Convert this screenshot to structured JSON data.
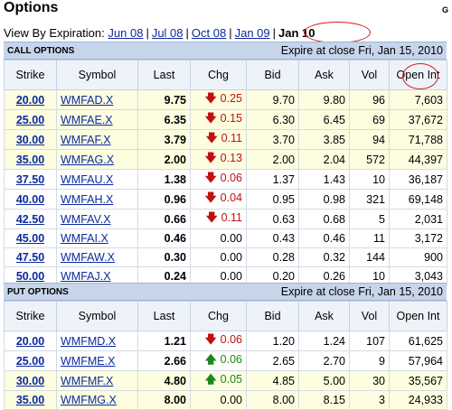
{
  "page_title": "Options",
  "corner_text": "G",
  "expiration": {
    "label": "View By Expiration:",
    "links": [
      "Jun 08",
      "Jul 08",
      "Oct 08",
      "Jan 09"
    ],
    "current": "Jan 10"
  },
  "colors": {
    "link": "#0b2a9e",
    "down": "#c21010",
    "up": "#1a8a1a",
    "highlight_oval": "#d21c1c",
    "in_the_money_row": "#fdfde0",
    "section_header": "#c6d5ea"
  },
  "columns": [
    "Strike",
    "Symbol",
    "Last",
    "Chg",
    "Bid",
    "Ask",
    "Vol",
    "Open Int"
  ],
  "call": {
    "title": "CALL OPTIONS",
    "expire": "Expire at close Fri, Jan 15, 2010",
    "rows": [
      {
        "strike": "20.00",
        "symbol": "WMFAD.X",
        "last": "9.75",
        "chg": "0.25",
        "dir": "down",
        "bid": "9.70",
        "ask": "9.80",
        "vol": "96",
        "oi": "7,603",
        "itm": true
      },
      {
        "strike": "25.00",
        "symbol": "WMFAE.X",
        "last": "6.35",
        "chg": "0.15",
        "dir": "down",
        "bid": "6.30",
        "ask": "6.45",
        "vol": "69",
        "oi": "37,672",
        "itm": true
      },
      {
        "strike": "30.00",
        "symbol": "WMFAF.X",
        "last": "3.79",
        "chg": "0.11",
        "dir": "down",
        "bid": "3.70",
        "ask": "3.85",
        "vol": "94",
        "oi": "71,788",
        "itm": true
      },
      {
        "strike": "35.00",
        "symbol": "WMFAG.X",
        "last": "2.00",
        "chg": "0.13",
        "dir": "down",
        "bid": "2.00",
        "ask": "2.04",
        "vol": "572",
        "oi": "44,397",
        "itm": true
      },
      {
        "strike": "37.50",
        "symbol": "WMFAU.X",
        "last": "1.38",
        "chg": "0.06",
        "dir": "down",
        "bid": "1.37",
        "ask": "1.43",
        "vol": "10",
        "oi": "36,187",
        "itm": false
      },
      {
        "strike": "40.00",
        "symbol": "WMFAH.X",
        "last": "0.96",
        "chg": "0.04",
        "dir": "down",
        "bid": "0.95",
        "ask": "0.98",
        "vol": "321",
        "oi": "69,148",
        "itm": false
      },
      {
        "strike": "42.50",
        "symbol": "WMFAV.X",
        "last": "0.66",
        "chg": "0.11",
        "dir": "down",
        "bid": "0.63",
        "ask": "0.68",
        "vol": "5",
        "oi": "2,031",
        "itm": false
      },
      {
        "strike": "45.00",
        "symbol": "WMFAI.X",
        "last": "0.46",
        "chg": "0.00",
        "dir": "none",
        "bid": "0.43",
        "ask": "0.46",
        "vol": "11",
        "oi": "3,172",
        "itm": false
      },
      {
        "strike": "47.50",
        "symbol": "WMFAW.X",
        "last": "0.30",
        "chg": "0.00",
        "dir": "none",
        "bid": "0.28",
        "ask": "0.32",
        "vol": "144",
        "oi": "900",
        "itm": false
      },
      {
        "strike": "50.00",
        "symbol": "WMFAJ.X",
        "last": "0.24",
        "chg": "0.00",
        "dir": "none",
        "bid": "0.20",
        "ask": "0.26",
        "vol": "10",
        "oi": "3,043",
        "itm": false
      }
    ]
  },
  "put": {
    "title": "PUT OPTIONS",
    "expire": "Expire at close Fri, Jan 15, 2010",
    "rows": [
      {
        "strike": "20.00",
        "symbol": "WMFMD.X",
        "last": "1.21",
        "chg": "0.06",
        "dir": "down",
        "bid": "1.20",
        "ask": "1.24",
        "vol": "107",
        "oi": "61,625",
        "itm": false
      },
      {
        "strike": "25.00",
        "symbol": "WMFME.X",
        "last": "2.66",
        "chg": "0.06",
        "dir": "up",
        "bid": "2.65",
        "ask": "2.70",
        "vol": "9",
        "oi": "57,964",
        "itm": false
      },
      {
        "strike": "30.00",
        "symbol": "WMFMF.X",
        "last": "4.80",
        "chg": "0.05",
        "dir": "up",
        "bid": "4.85",
        "ask": "5.00",
        "vol": "30",
        "oi": "35,567",
        "itm": true
      },
      {
        "strike": "35.00",
        "symbol": "WMFMG.X",
        "last": "8.00",
        "chg": "0.00",
        "dir": "none",
        "bid": "8.00",
        "ask": "8.15",
        "vol": "3",
        "oi": "24,933",
        "itm": true
      }
    ]
  }
}
